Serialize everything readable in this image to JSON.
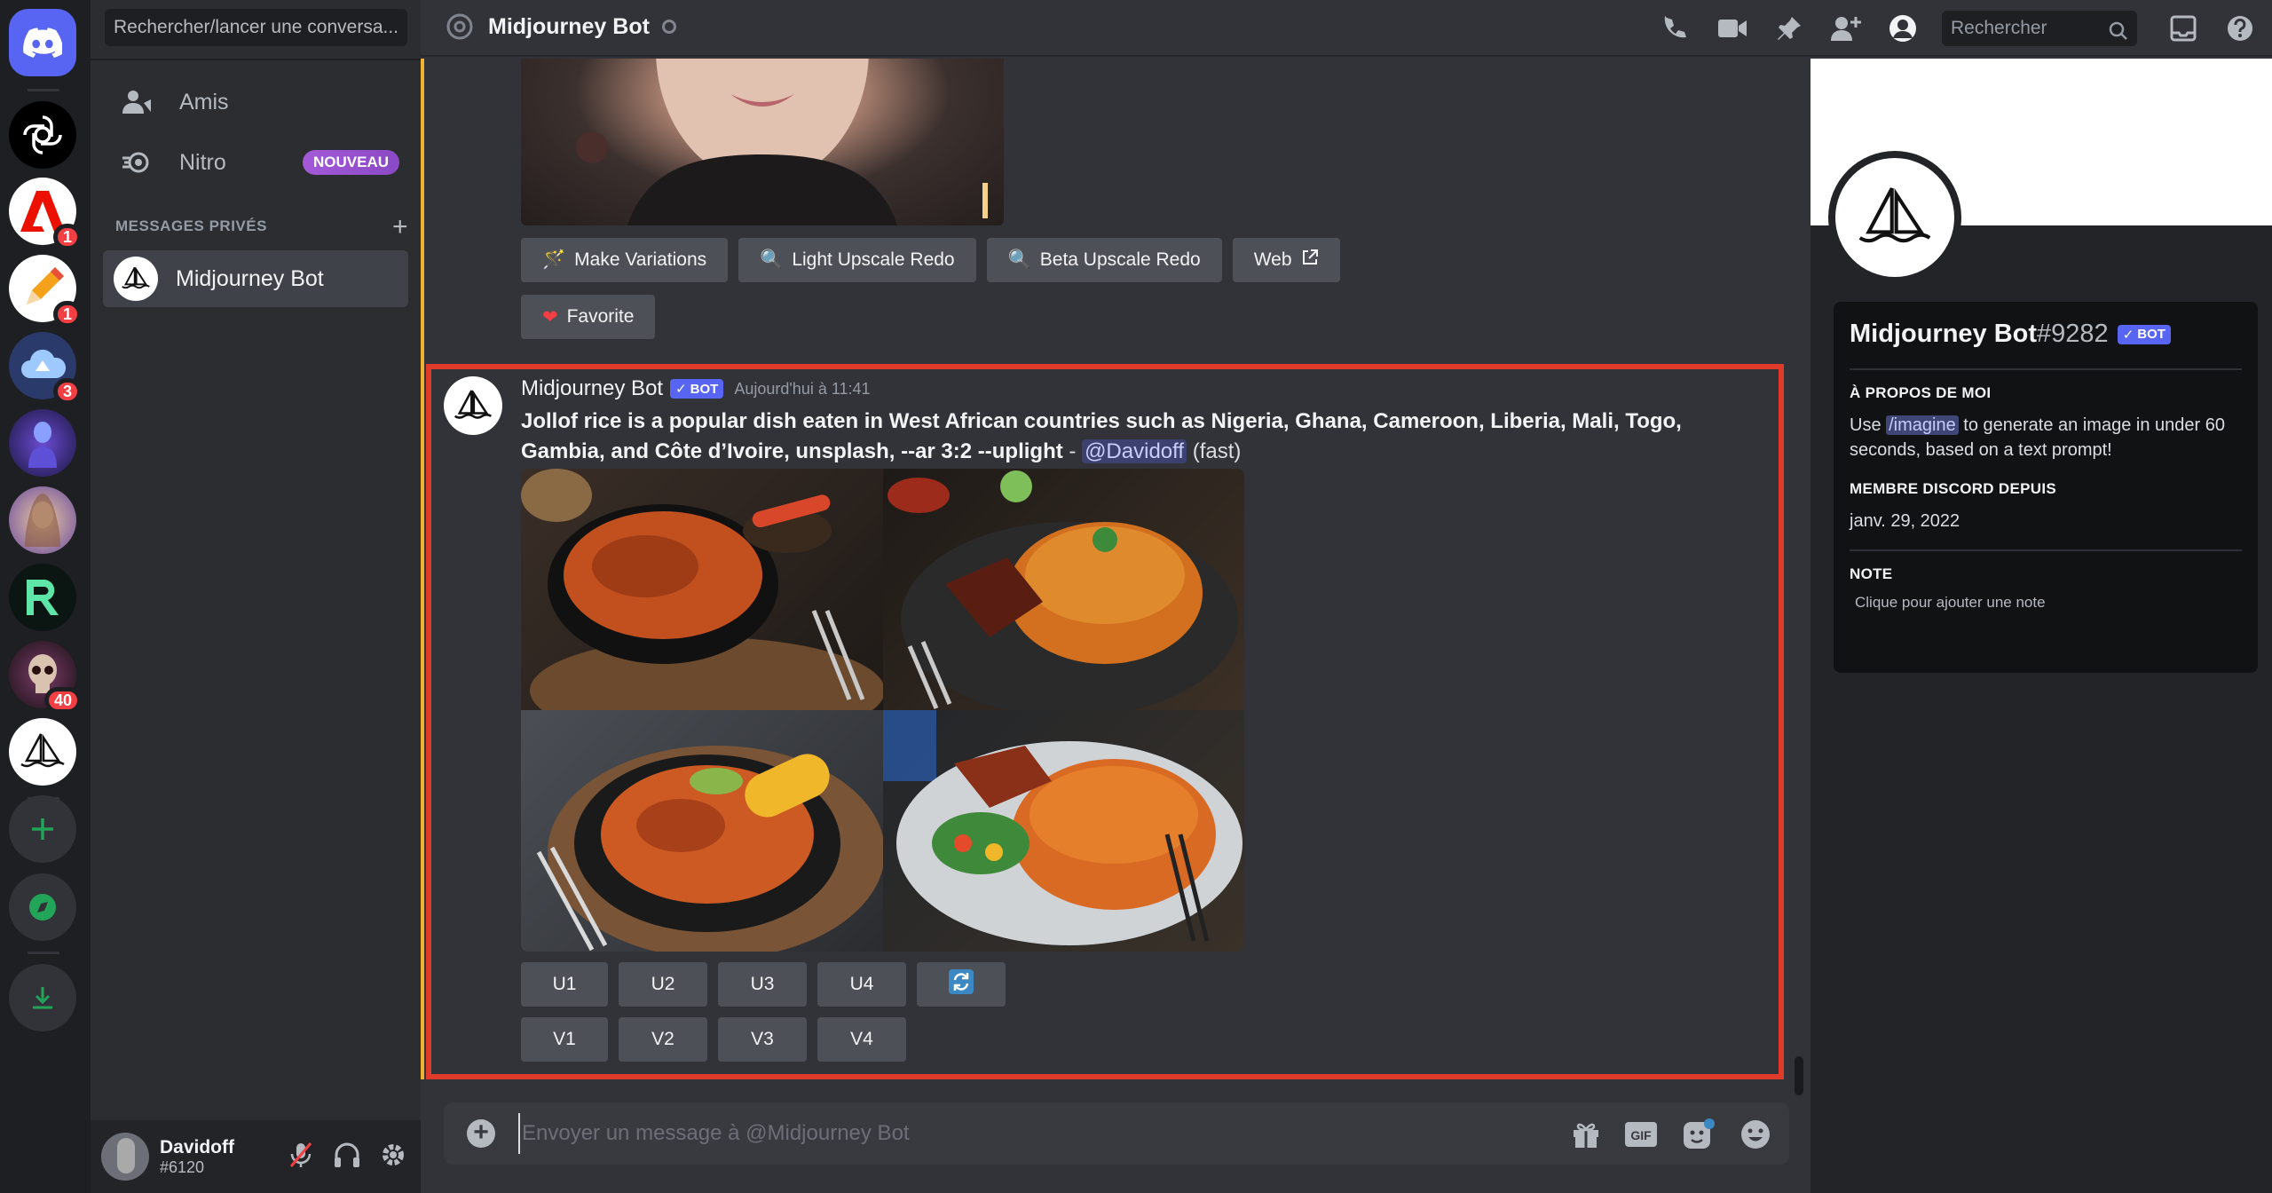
{
  "rail": {
    "badges": {
      "adobe": "1",
      "pencil": "1",
      "cloud": "3",
      "skull": "40"
    }
  },
  "dm": {
    "search_placeholder": "Rechercher/lancer une conversa...",
    "friends_label": "Amis",
    "nitro_label": "Nitro",
    "nitro_badge": "NOUVEAU",
    "section_title": "MESSAGES PRIVÉS",
    "active_dm": "Midjourney Bot"
  },
  "user": {
    "name": "Davidoff",
    "tag": "#6120"
  },
  "header": {
    "title": "Midjourney Bot",
    "search_placeholder": "Rechercher"
  },
  "prev_message": {
    "buttons": [
      "Make Variations",
      "Light Upscale Redo",
      "Beta Upscale Redo",
      "Web"
    ],
    "favorite": "Favorite"
  },
  "message": {
    "author": "Midjourney Bot",
    "bot_tag": "BOT",
    "time": "Aujourd'hui à 11:41",
    "prompt": "Jollof rice is a popular dish eaten in West African countries such as Nigeria, Ghana, Cameroon, Liberia, Mali, Togo, Gambia, and Côte d’Ivoire, unsplash, --ar 3:2 --uplight",
    "dash": " - ",
    "mention": "@Davidoff",
    "speed": " (fast)",
    "upscale_buttons": [
      "U1",
      "U2",
      "U3",
      "U4"
    ],
    "variation_buttons": [
      "V1",
      "V2",
      "V3",
      "V4"
    ]
  },
  "composer": {
    "placeholder": "Envoyer un message à @Midjourney Bot"
  },
  "profile": {
    "name": "Midjourney Bot",
    "discriminator": "#9282",
    "bot_tag": "BOT",
    "about_title": "À PROPOS DE MOI",
    "about_pre": "Use ",
    "about_cmd": "/imagine",
    "about_post": " to generate an image in under 60 seconds, based on a text prompt!",
    "member_title": "MEMBRE DISCORD DEPUIS",
    "member_since": "janv. 29, 2022",
    "note_title": "NOTE",
    "note_placeholder": "Clique pour ajouter une note"
  },
  "colors": {
    "accent": "#5865f2",
    "highlight": "#e03b2a",
    "nitro": "#9b59b6"
  }
}
